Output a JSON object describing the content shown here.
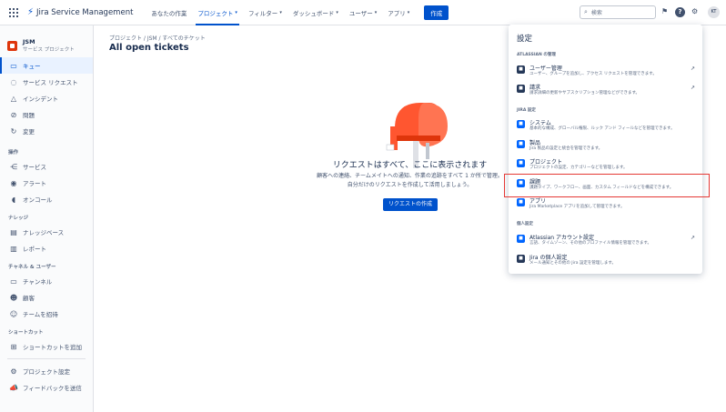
{
  "topbar": {
    "logo_text": "Jira Service Management",
    "nav": [
      {
        "label": "あなたの作業",
        "chevron": false,
        "active": false
      },
      {
        "label": "プロジェクト",
        "chevron": true,
        "active": true
      },
      {
        "label": "フィルター",
        "chevron": true,
        "active": false
      },
      {
        "label": "ダッシュボード",
        "chevron": true,
        "active": false
      },
      {
        "label": "ユーザー",
        "chevron": true,
        "active": false
      },
      {
        "label": "アプリ",
        "chevron": true,
        "active": false
      }
    ],
    "create_label": "作成",
    "search_placeholder": "検索",
    "avatar_initials": "KT"
  },
  "sidebar": {
    "project_name": "JSM",
    "project_type": "サービス プロジェクト",
    "group1": [
      {
        "label": "キュー",
        "icon": "queue-icon",
        "glyph": "▭"
      },
      {
        "label": "サービス リクエスト",
        "icon": "chat-icon",
        "glyph": "◌"
      },
      {
        "label": "インシデント",
        "icon": "warning-icon",
        "glyph": "△"
      },
      {
        "label": "問題",
        "icon": "problem-icon",
        "glyph": "⊘"
      },
      {
        "label": "変更",
        "icon": "change-icon",
        "glyph": "↻"
      }
    ],
    "section_ops": "操作",
    "group2": [
      {
        "label": "サービス",
        "icon": "service-icon",
        "glyph": "⋲"
      },
      {
        "label": "アラート",
        "icon": "alert-icon",
        "glyph": "◉"
      },
      {
        "label": "オンコール",
        "icon": "oncall-icon",
        "glyph": "◖"
      }
    ],
    "section_knowledge": "ナレッジ",
    "group3": [
      {
        "label": "ナレッジベース",
        "icon": "knowledge-icon",
        "glyph": "▤"
      },
      {
        "label": "レポート",
        "icon": "report-icon",
        "glyph": "▥"
      }
    ],
    "section_channels": "チャネル & ユーザー",
    "group4": [
      {
        "label": "チャンネル",
        "icon": "channel-icon",
        "glyph": "▭"
      },
      {
        "label": "顧客",
        "icon": "customers-icon",
        "glyph": "☻"
      },
      {
        "label": "チームを招待",
        "icon": "invite-icon",
        "glyph": "☺"
      }
    ],
    "section_shortcuts": "ショートカット",
    "group5": [
      {
        "label": "ショートカットを追加",
        "icon": "add-shortcut-icon",
        "glyph": "⊞"
      }
    ],
    "group6": [
      {
        "label": "プロジェクト設定",
        "icon": "gear-icon",
        "glyph": "⚙"
      },
      {
        "label": "フィードバックを送信",
        "icon": "megaphone-icon",
        "glyph": "📣"
      }
    ]
  },
  "main": {
    "breadcrumb": "プロジェクト  /  JSM  /  すべてのチケット",
    "title": "All open tickets",
    "empty_title": "リクエストはすべて、ここに表示されます",
    "empty_desc": "顧客への連絡、チームメイトへの通知、作業の追跡をすべて 1 か所で管理。自分だけのリクエストを作成して活用しましょう。",
    "request_button": "リクエストの作成"
  },
  "settings_panel": {
    "title": "設定",
    "section_atlassian": "ATLASSIAN の管理",
    "section_jira": "JIRA 設定",
    "section_personal": "個人設定",
    "items": [
      {
        "name": "ユーザー管理",
        "desc": "ユーザー、グループを追加し、アクセス リクエストを管理できます。",
        "external": true,
        "icon": "user-management-icon"
      },
      {
        "name": "請求",
        "desc": "請求詳細の更新やサブスクリプション管理などができます。",
        "external": true,
        "icon": "billing-icon"
      },
      {
        "name": "システム",
        "desc": "基本的な構成、グローバル権限、ルック アンド フィールなどを管理できます。",
        "external": false,
        "icon": "system-icon"
      },
      {
        "name": "製品",
        "desc": "Jira 製品の設定と統合を管理できます。",
        "external": false,
        "icon": "products-icon"
      },
      {
        "name": "プロジェクト",
        "desc": "プロジェクトの設定、カテゴリーなどを管理します。",
        "external": false,
        "icon": "projects-icon"
      },
      {
        "name": "課題",
        "desc": "課題タイプ、ワークフロー、画面、カスタム フィールドなどを構成できます。",
        "external": false,
        "icon": "issues-icon"
      },
      {
        "name": "アプリ",
        "desc": "Jira Marketplace アプリを追加して管理できます。",
        "external": false,
        "icon": "apps-icon"
      },
      {
        "name": "Atlassian アカウント設定",
        "desc": "言語、タイムゾーン、その他のプロファイル情報を管理できます。",
        "external": true,
        "icon": "account-icon"
      },
      {
        "name": "Jira の個人設定",
        "desc": "メール通知とその他の Jira 設定を管理します。",
        "external": false,
        "icon": "personal-settings-icon"
      }
    ]
  }
}
